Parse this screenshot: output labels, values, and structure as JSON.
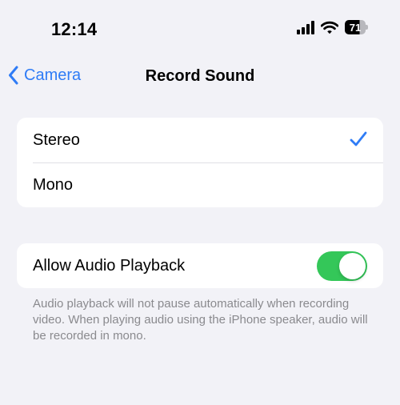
{
  "status_bar": {
    "time": "12:14",
    "battery_level": "71",
    "icons": [
      "signal-icon",
      "wifi-icon",
      "battery-icon"
    ]
  },
  "nav": {
    "back_label": "Camera",
    "title": "Record Sound"
  },
  "sound_options": [
    {
      "label": "Stereo",
      "selected": true
    },
    {
      "label": "Mono",
      "selected": false
    }
  ],
  "playback": {
    "label": "Allow Audio Playback",
    "enabled": true,
    "description": "Audio playback will not pause automatically when recording video. When playing audio using the iPhone speaker, audio will be recorded in mono."
  },
  "colors": {
    "background": "#f2f2f7",
    "accent": "#2f7cf6",
    "toggle_on": "#34c759",
    "secondary_text": "#8a8a8e"
  }
}
